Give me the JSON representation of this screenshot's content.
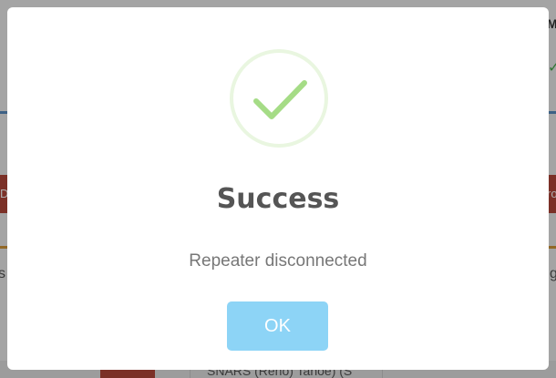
{
  "background": {
    "top_right_fragment": "M",
    "left_red_fragment": "D",
    "right_red_fragment": "ro",
    "left_text_fragment": "s",
    "right_text_fragment": "g",
    "bottom_cell_text": "SNARS (Reno) Tahoe) (S"
  },
  "dialog": {
    "icon": "success-check-icon",
    "title": "Success",
    "message": "Repeater disconnected",
    "ok_label": "OK"
  },
  "colors": {
    "success_green": "#a5dc86",
    "success_ring": "#e9f6e0",
    "ok_button": "#8dd4f6",
    "title": "#555555",
    "message": "#777777"
  }
}
